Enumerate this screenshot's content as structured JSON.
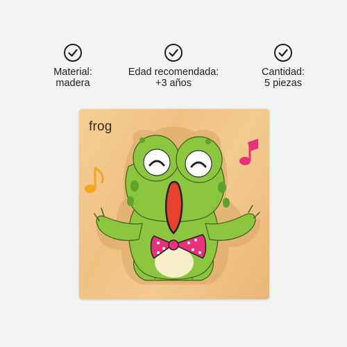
{
  "features": [
    {
      "icon": "check-circle-icon",
      "line1": "Material:",
      "line2": "madera"
    },
    {
      "icon": "check-circle-icon",
      "line1": "Edad recomendada:",
      "line2": "+3 años"
    },
    {
      "icon": "check-circle-icon",
      "line1": "Cantidad:",
      "line2": "5 piezas"
    }
  ],
  "product": {
    "puzzle_word": "frog",
    "colors": {
      "board": "#f0c385",
      "frog_green": "#8cc63f",
      "frog_dark_green": "#5aa32d",
      "mouth": "#e8412c",
      "bow": "#e8317a",
      "note_pink": "#e8317a",
      "note_yellow": "#f2a51d"
    }
  }
}
